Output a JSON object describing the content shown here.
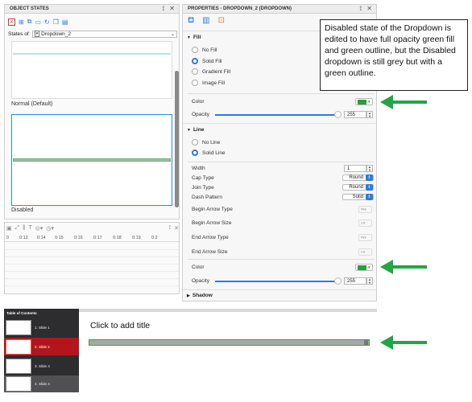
{
  "object_states_panel": {
    "title": "OBJECT STATES",
    "states_of_label": "States of",
    "states_of_value": "Dropdown_2",
    "states": [
      {
        "label": "Normal (Default)"
      },
      {
        "label": "Disabled"
      }
    ]
  },
  "timeline": {
    "ticks": [
      "0",
      "0:12",
      "0:14",
      "0:15",
      "0:16",
      "0:17",
      "0:18",
      "0:19",
      "0:2"
    ]
  },
  "properties_panel": {
    "title": "PROPERTIES - DROPDOWN_2 (DROPDOWN)",
    "fill": {
      "section": "Fill",
      "options": [
        "No Fill",
        "Solid Fill",
        "Gradient Fill",
        "Image Fill"
      ],
      "selected": "Solid Fill",
      "color_label": "Color",
      "color_value": "#22a33a",
      "opacity_label": "Opacity",
      "opacity_value": "255"
    },
    "line": {
      "section": "Line",
      "options": [
        "No Line",
        "Solid Line"
      ],
      "selected": "Solid Line",
      "width_label": "Width",
      "width_value": "1",
      "cap_label": "Cap Type",
      "cap_value": "Round",
      "join_label": "Join Type",
      "join_value": "Round",
      "dash_label": "Dash Pattern",
      "dash_value": "Solid",
      "begin_arrow_type_label": "Begin Arrow Type",
      "begin_arrow_size_label": "Begin Arrow Size",
      "end_arrow_type_label": "End Arrow Type",
      "end_arrow_size_label": "End Arrow Size",
      "color_label": "Color",
      "color_value": "#22a33a",
      "opacity_label": "Opacity",
      "opacity_value": "255"
    },
    "shadow": {
      "section": "Shadow"
    }
  },
  "annotation": {
    "text": "Disabled state of the Dropdown is edited to have full opacity green fill and green outline, but the Disabled dropdown is still grey but with a green outline."
  },
  "slides_panel": {
    "title": "Table of Contents",
    "items": [
      {
        "label": "1. Slide 1"
      },
      {
        "label": "2. Slide 2"
      },
      {
        "label": "3. Slide 3"
      },
      {
        "label": "4. Slide 4"
      }
    ]
  },
  "slide_canvas": {
    "title_placeholder": "Click to add title"
  },
  "colors": {
    "arrow_green": "#23a545",
    "selected_slide_red": "#b3151a",
    "accent_blue": "#2b7be4"
  }
}
